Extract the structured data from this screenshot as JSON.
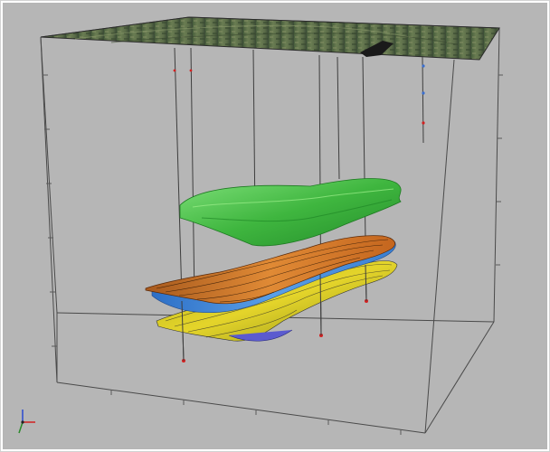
{
  "viewer": {
    "background_color": "#b6b6b6",
    "box_line_color": "#4a4a4a",
    "well_line_color": "#3e3e3e",
    "well_marker_colors": [
      "#d22020",
      "#3a6fd0"
    ]
  },
  "surfaces": [
    {
      "name": "green-horizon",
      "color": "#3fb63f"
    },
    {
      "name": "orange-horizon",
      "color": "#d2782a"
    },
    {
      "name": "blue-band",
      "color": "#4a8ed8"
    },
    {
      "name": "yellow-horizon",
      "color": "#d8cc22"
    }
  ],
  "top_surface": {
    "name": "satellite-imagery",
    "base_color": "#4f6b45"
  },
  "axes_gizmo": {
    "x_color": "#d22020",
    "y_color": "#2a8a2a",
    "z_color": "#2a4ad0"
  }
}
